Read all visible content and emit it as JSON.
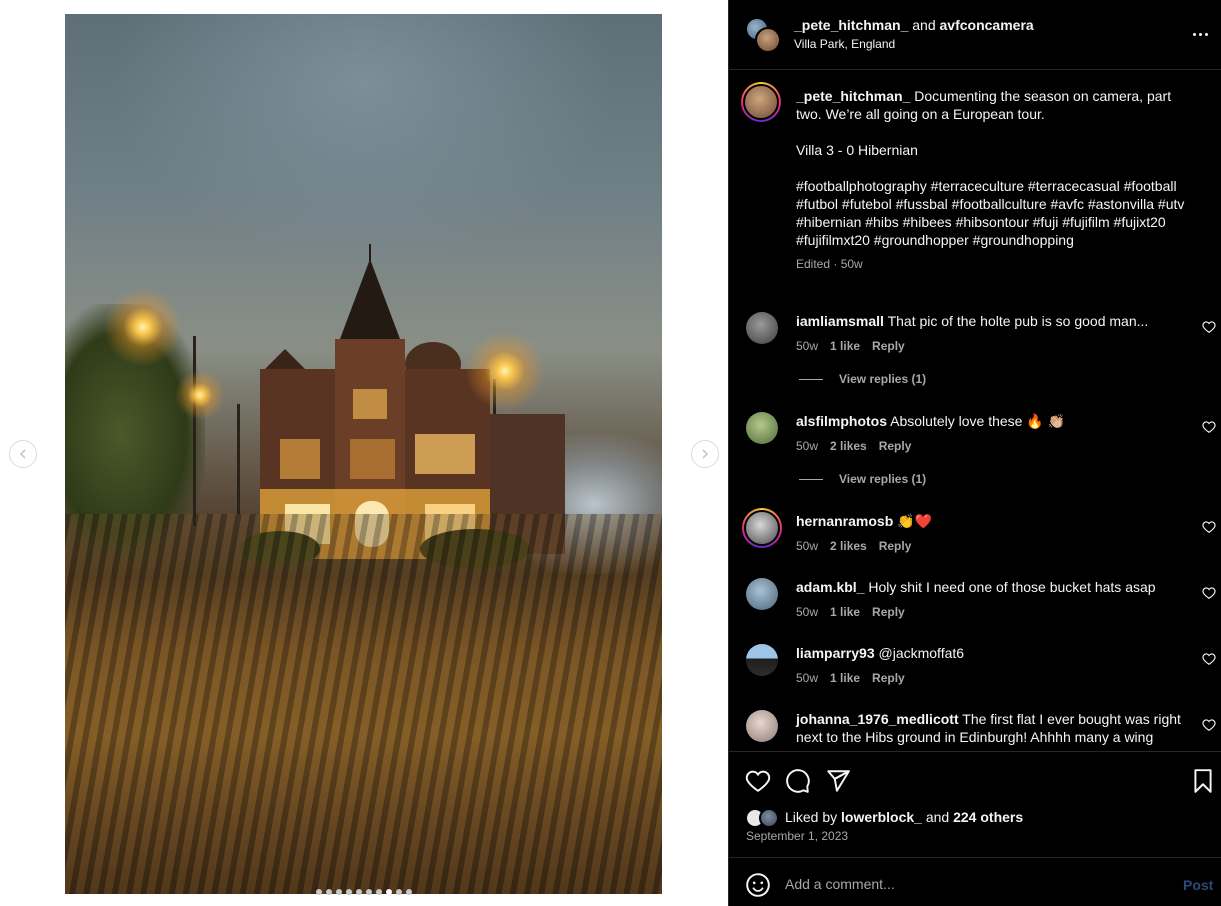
{
  "media": {
    "carousel_dots": 10,
    "active_dot_index": 7
  },
  "header": {
    "user_primary": "_pete_hitchman_",
    "and_text": "and",
    "user_collab": "avfconcamera",
    "location": "Villa Park, England"
  },
  "caption": {
    "username": "_pete_hitchman_",
    "text": "Documenting the season on camera, part two. We’re all going on a European tour.",
    "score": "Villa 3 - 0 Hibernian",
    "hashtags": "#footballphotography #terraceculture #terracecasual #football #futbol #futebol #fussbal #footballculture #avfc #astonvilla #utv #hibernian #hibs #hibees #hibsontour #fuji #fujifilm #fujixt20 #fujifilmxt20 #groundhopper #groundhopping",
    "edited": "Edited",
    "age": "50w"
  },
  "comments": [
    {
      "username": "iamliamsmall",
      "text": "That pic of the holte pub is so good man...",
      "age": "50w",
      "likes": "1 like",
      "reply": "Reply",
      "view_replies": "View replies (1)"
    },
    {
      "username": "alsfilmphotos",
      "text": "Absolutely love these 🔥 👏🏼",
      "age": "50w",
      "likes": "2 likes",
      "reply": "Reply",
      "view_replies": "View replies (1)"
    },
    {
      "username": "hernanramosb",
      "text": "👏❤️",
      "age": "50w",
      "likes": "2 likes",
      "reply": "Reply"
    },
    {
      "username": "adam.kbl_",
      "text": "Holy shit I need one of those bucket hats asap",
      "age": "50w",
      "likes": "1 like",
      "reply": "Reply"
    },
    {
      "username": "liamparry93",
      "text": "@jackmoffat6",
      "age": "50w",
      "likes": "1 like",
      "reply": "Reply"
    },
    {
      "username": "johanna_1976_medlicott",
      "text": "The first flat I ever bought was right next to the Hibs ground in Edinburgh! Ahhhh many a wing"
    }
  ],
  "actions": {
    "liked_by_prefix": "Liked by",
    "liked_by_user": "lowerblock_",
    "liked_by_and": "and",
    "liked_by_others": "224 others",
    "date": "September 1, 2023"
  },
  "comment_box": {
    "placeholder": "Add a comment...",
    "post_label": "Post"
  },
  "colors": {
    "panel_bg": "#000000",
    "text_primary": "#f5f5f5",
    "text_secondary": "#a8a8a8",
    "divider": "#262626",
    "post_button_disabled": "#2b4a75"
  }
}
